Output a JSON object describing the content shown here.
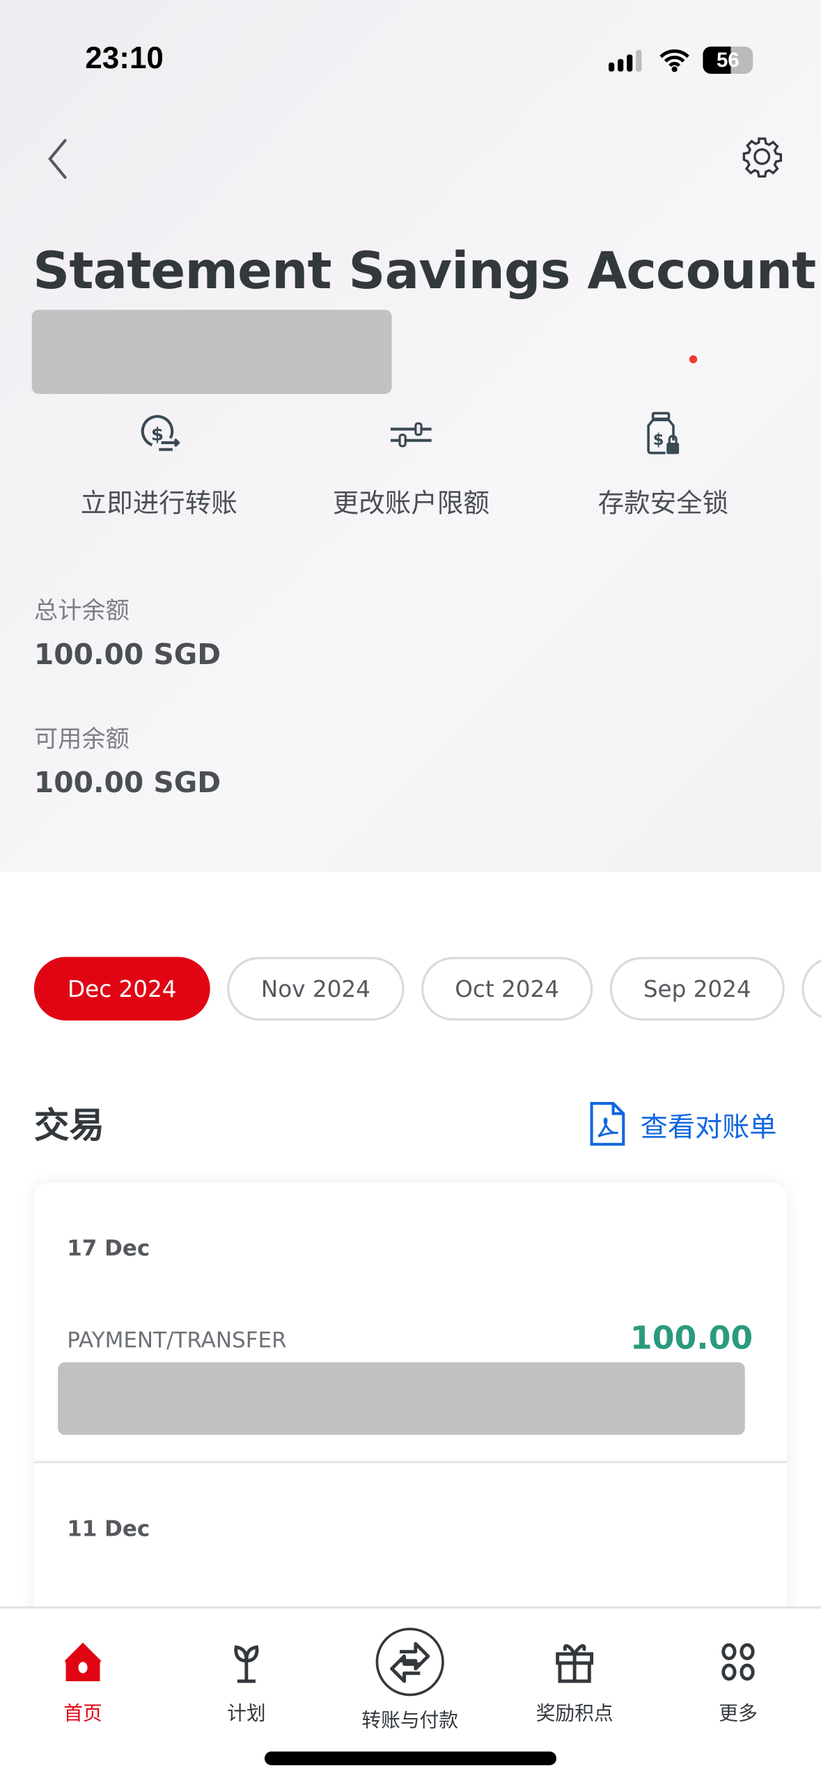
{
  "status_bar": {
    "time": "23:10",
    "battery": "56"
  },
  "header": {
    "title": "Statement Savings Account"
  },
  "actions": [
    {
      "label": "立即进行转账",
      "icon": "dollar-transfer-icon"
    },
    {
      "label": "更改账户限额",
      "icon": "sliders-icon"
    },
    {
      "label": "存款安全锁",
      "icon": "money-jar-lock-icon"
    }
  ],
  "balances": {
    "total_label": "总计余额",
    "total_value": "100.00 SGD",
    "available_label": "可用余额",
    "available_value": "100.00 SGD"
  },
  "months": [
    "Dec 2024",
    "Nov 2024",
    "Oct 2024",
    "Sep 2024"
  ],
  "transactions": {
    "heading": "交易",
    "statement_link": "查看对账单",
    "items": [
      {
        "date": "17 Dec",
        "type": "PAYMENT/TRANSFER",
        "amount": "100.00"
      },
      {
        "date": "11 Dec"
      }
    ]
  },
  "nav": [
    {
      "label": "首页",
      "icon": "home-icon",
      "active": true
    },
    {
      "label": "计划",
      "icon": "sprout-icon"
    },
    {
      "label": "转账与付款",
      "icon": "transfer-arrows-icon"
    },
    {
      "label": "奖励积点",
      "icon": "gift-icon"
    },
    {
      "label": "更多",
      "icon": "grid-dots-icon"
    }
  ],
  "colors": {
    "accent": "#e10514",
    "positive": "#2a9a7e",
    "link": "#1166e0"
  }
}
